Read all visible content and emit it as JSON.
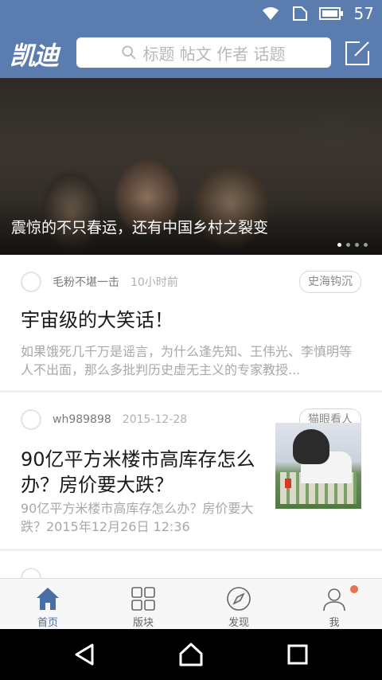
{
  "status": {
    "battery_text": "57"
  },
  "header": {
    "logo": "凯迪",
    "search_placeholder": "标题 帖文 作者 话题"
  },
  "banner": {
    "caption": "震惊的不只春运，还有中国乡村之裂变",
    "page_count": 4,
    "active_page": 1
  },
  "feed": [
    {
      "author": "毛粉不堪一击",
      "time": "10小时前",
      "tag": "史海钩沉",
      "title": "宇宙级的大笑话！",
      "excerpt": "如果饿死几千万是谣言，为什么逢先知、王伟光、李慎明等人不出面，那么多批判历史虚无主义的专家教授..."
    },
    {
      "author": "wh989898",
      "time": "2015-12-28",
      "tag": "猫眼看人",
      "title": "90亿平方米楼市高库存怎么办？房价要大跌？",
      "excerpt": "90亿平方米楼市高库存怎么办？房价要大跌？2015年12月26日 12:36",
      "has_thumbnail": true
    }
  ],
  "tabs": [
    {
      "label": "首页",
      "icon": "home-icon",
      "active": true
    },
    {
      "label": "版块",
      "icon": "grid-icon",
      "active": false
    },
    {
      "label": "发现",
      "icon": "compass-icon",
      "active": false
    },
    {
      "label": "我",
      "icon": "person-icon",
      "active": false,
      "badge": true
    }
  ],
  "colors": {
    "primary": "#5b7cae",
    "tab_active": "#4a6fa5",
    "badge": "#e8714f"
  },
  "system_nav": [
    "back-icon",
    "home-circle-icon",
    "recents-icon"
  ]
}
